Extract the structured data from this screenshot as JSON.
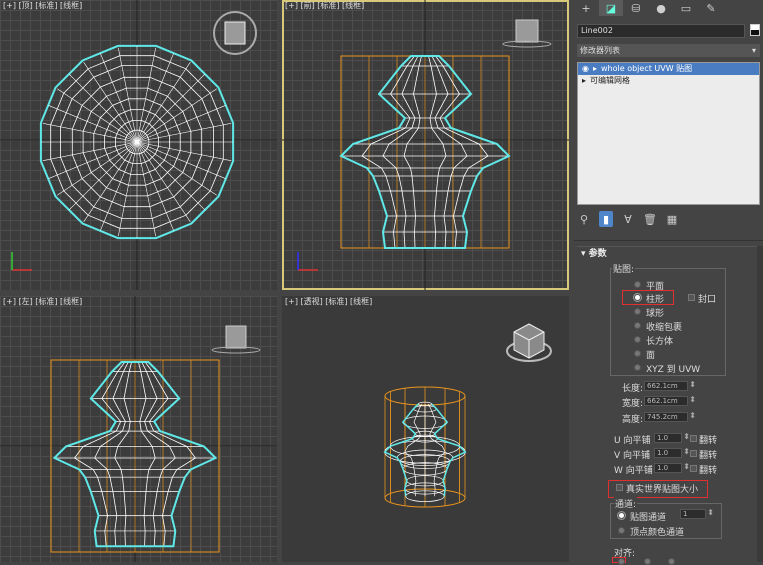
{
  "viewports": {
    "top": {
      "label": "[+] [顶] [标准] [线框]"
    },
    "front": {
      "label": "[+] [前] [标准] [线框]"
    },
    "left": {
      "label": "[+] [左] [标准] [线框]"
    },
    "perspective": {
      "label": "[+] [透视] [标准] [线框]"
    }
  },
  "command_panel": {
    "tabs": [
      "create-icon",
      "modify-icon",
      "hierarchy-icon",
      "motion-icon",
      "display-icon",
      "utilities-icon"
    ],
    "object_name": "Line002",
    "object_color": "#ffffff",
    "modifier_list": "修改器列表",
    "stack": [
      {
        "label": "whole object UVW 贴图",
        "selected": true
      },
      {
        "label": "可编辑网格",
        "selected": false
      }
    ]
  },
  "params": {
    "title": "参数",
    "mapping_group": "贴图:",
    "mapping_options": [
      "平面",
      "柱形",
      "球形",
      "收缩包裹",
      "长方体",
      "面",
      "XYZ 到 UVW"
    ],
    "mapping_selected": "柱形",
    "cap_label": "封口",
    "length_label": "长度:",
    "length_value": "662.1cm",
    "width_label": "宽度:",
    "width_value": "662.1cm",
    "height_label": "高度:",
    "height_value": "745.2cm",
    "u_tile_label": "U 向平铺",
    "u_tile_value": "1.0",
    "v_tile_label": "V 向平铺",
    "v_tile_value": "1.0",
    "w_tile_label": "W 向平铺",
    "w_tile_value": "1.0",
    "flip_label": "翻转",
    "real_world_label": "真实世界贴图大小",
    "channel_group": "通道:",
    "map_channel_label": "贴图通道",
    "map_channel_value": "1",
    "vertex_color_label": "顶点颜色通道",
    "align_group": "对齐:"
  },
  "colors": {
    "wire_cyan": "#5fe8e8",
    "wire_white": "#ffffff",
    "gizmo_orange": "#e8941c",
    "selection_blue": "#4a7cc2",
    "highlight_red": "#e03030"
  }
}
